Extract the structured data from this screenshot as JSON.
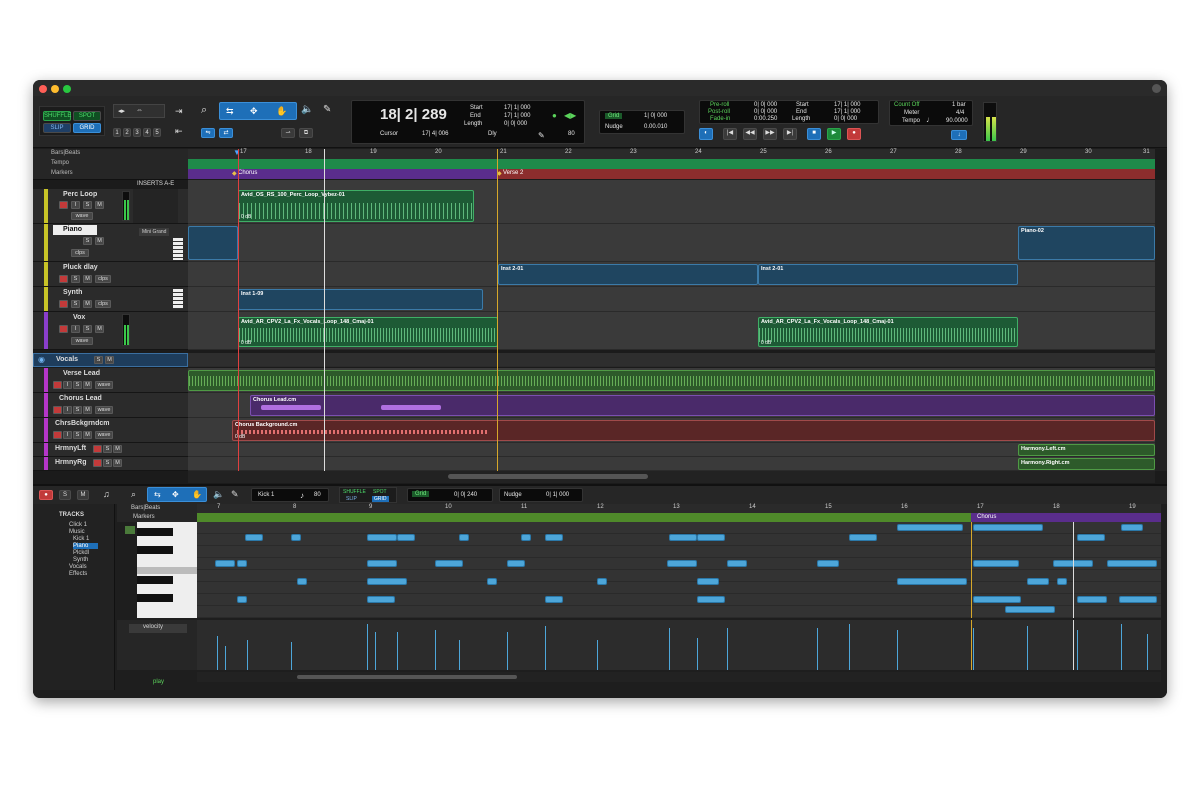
{
  "window": {
    "colors": {
      "close": "#ff5f57",
      "minimize": "#febc2e",
      "zoom": "#28c840"
    }
  },
  "toolbar": {
    "edit_modes": {
      "shuffle": "SHUFFLE",
      "spot": "SPOT",
      "slip": "SLIP",
      "grid": "GRID"
    },
    "zoom_presets": [
      "1",
      "2",
      "3",
      "4",
      "5"
    ],
    "counter": {
      "main": "18| 2| 289",
      "cursor_label": "Cursor",
      "cursor_value": "17| 4| 006"
    },
    "selection": {
      "start_label": "Start",
      "end_label": "End",
      "length_label": "Length",
      "start": "17| 1| 000",
      "end": "17| 1| 000",
      "length": "0| 0| 000"
    },
    "dly_label": "Dly",
    "nudge_value_top": "80",
    "grid": {
      "grid_label": "Grid",
      "grid_value": "1| 0| 000",
      "nudge_label": "Nudge",
      "nudge_value": "0.00.010"
    },
    "transport": {
      "preroll_label": "Pre-roll",
      "postroll_label": "Post-roll",
      "fadein_label": "Fade-in",
      "preroll": "0| 0| 000",
      "postroll": "0| 0| 000",
      "fadein": "0:00.250",
      "start_label": "Start",
      "end_label": "End",
      "length_label": "Length",
      "start": "17| 1| 000",
      "end": "17| 1| 000",
      "length": "0| 0| 000"
    },
    "counter2": {
      "countoff_label": "Count Off",
      "meter_label": "Meter",
      "tempo_label": "Tempo",
      "countoff": "1 bar",
      "meter": "4/4",
      "tempo": "90.0000"
    }
  },
  "edit": {
    "rulers": {
      "bars": "Bars|Beats",
      "tempo": "Tempo",
      "markers": "Markers"
    },
    "bar_numbers": [
      "17",
      "18",
      "19",
      "20",
      "21",
      "22",
      "23",
      "24",
      "25",
      "26",
      "27",
      "28",
      "29",
      "30",
      "31"
    ],
    "markers": {
      "chorus": "Chorus",
      "verse2": "Verse 2"
    },
    "inserts_label": "INSERTS A-E",
    "mini_grand": "Mini Grand",
    "tracks": [
      {
        "name": "Perc Loop",
        "color": "#c7c427"
      },
      {
        "name": "Piano",
        "color": "#c7c427"
      },
      {
        "name": "Pluck dlay",
        "color": "#c7c427"
      },
      {
        "name": "Synth",
        "color": "#c7c427"
      },
      {
        "name": "Vox",
        "color": "#8a3ecb"
      },
      {
        "name": "Vocals",
        "color": "#2f6fb0"
      },
      {
        "name": "Verse Lead",
        "color": "#b536c9"
      },
      {
        "name": "Chorus Lead",
        "color": "#b536c9"
      },
      {
        "name": "ChrsBckgrndcm",
        "color": "#b536c9"
      },
      {
        "name": "HrmnyLft",
        "color": "#b536c9"
      },
      {
        "name": "HrmnyRg",
        "color": "#b536c9"
      }
    ],
    "track_btn": {
      "s": "S",
      "m": "M",
      "i": "I",
      "wave": "wave",
      "clips": "clps",
      "rec": "R"
    },
    "clips": {
      "perc": "Avid_OS_RS_100_Perc_Loop_Vybez-01",
      "perc_gain": "0 dB",
      "piano": "Piano-02",
      "inst2a": "Inst 2-01",
      "inst2b": "Inst 2-01",
      "inst1": "Inst 1-09",
      "vox1": "Avid_AR_CPV2_La_Fx_Vocals_Loop_148_Cmaj-01",
      "vox2": "Avid_AR_CPV2_La_Fx_Vocals_Loop_148_Cmaj-01",
      "vox_gain": "0 dB",
      "chorus_lead": "Chorus Lead.cm",
      "chorus_bg": "Chorus Background.cm",
      "chorus_bg_gain": "0 dB",
      "harmony_l": "Harmony.Left.cm",
      "harmony_r": "Harmony.Right.cm"
    }
  },
  "midi": {
    "track": "Kick 1",
    "velocity_value": "80",
    "grid_label": "Grid",
    "grid_value": "0| 0| 240",
    "nudge_label": "Nudge",
    "nudge_value": "0| 1| 000",
    "tracks_header": "TRACKS",
    "track_list": [
      "Click 1",
      "Music",
      "Kick 1",
      "Piano",
      "Plckdl",
      "Synth",
      "Vocals",
      "Effects"
    ],
    "rulers": {
      "bars": "Bars|Beats",
      "markers": "Markers"
    },
    "bar_numbers": [
      "7",
      "8",
      "9",
      "10",
      "11",
      "12",
      "13",
      "14",
      "15",
      "16",
      "17",
      "18",
      "19"
    ],
    "marker": "Chorus",
    "velocity_lane": "velocity",
    "status": "play"
  }
}
